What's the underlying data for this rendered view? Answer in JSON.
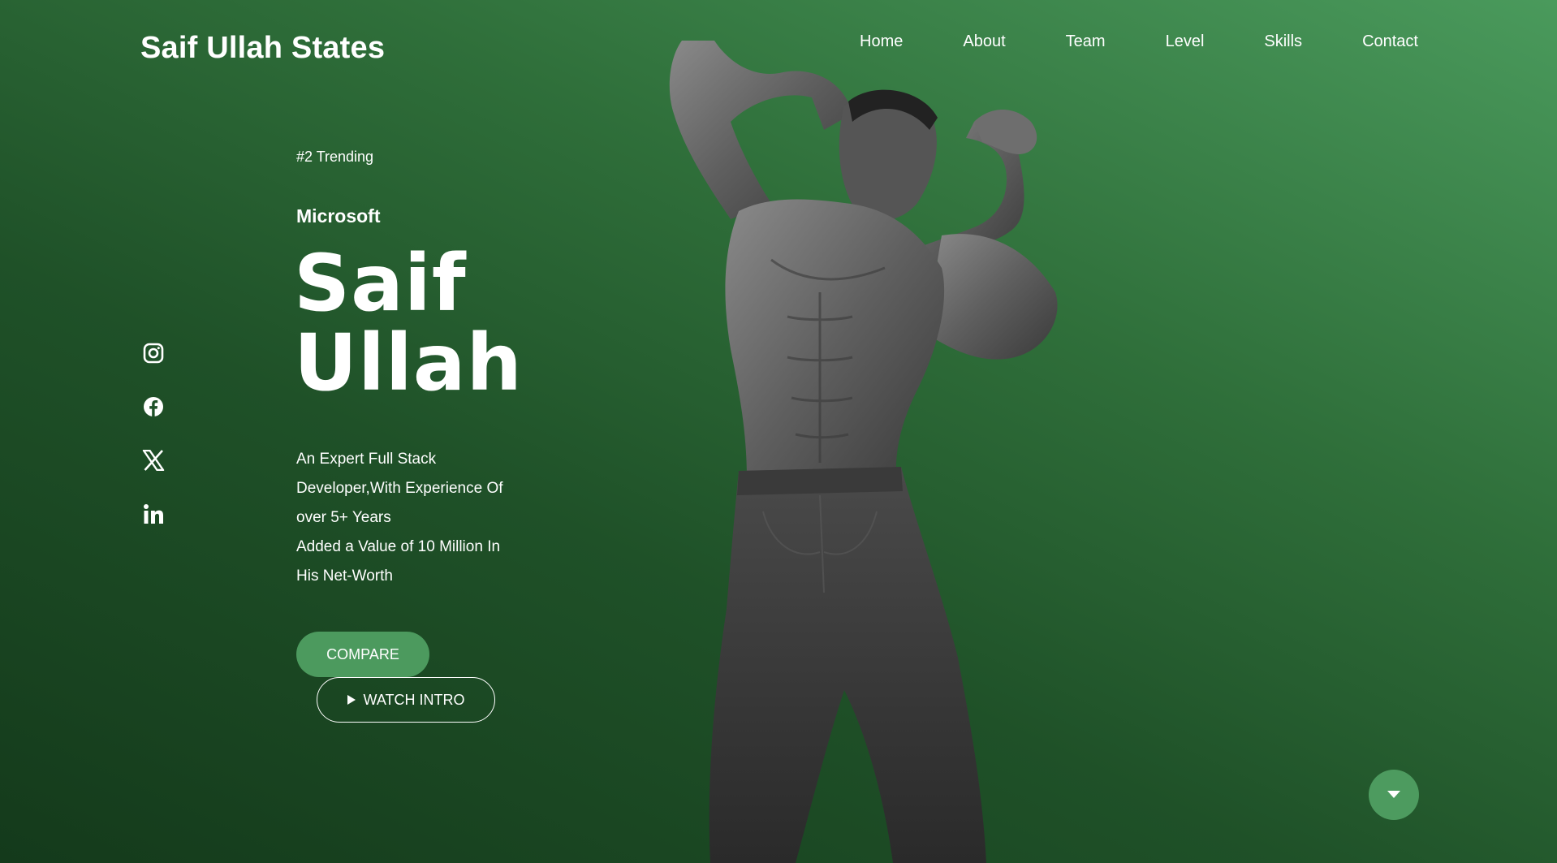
{
  "header": {
    "logo": "Saif Ullah States",
    "nav": [
      "Home",
      "About",
      "Team",
      "Level",
      "Skills",
      "Contact"
    ]
  },
  "socials": [
    {
      "icon": "instagram-icon"
    },
    {
      "icon": "facebook-icon"
    },
    {
      "icon": "x-icon"
    },
    {
      "icon": "linkedin-icon"
    }
  ],
  "hero": {
    "trending": "#2 Trending",
    "company": "Microsoft",
    "name_line1": "Saif",
    "name_line2": "Ullah",
    "description_lines": [
      "An Expert Full Stack",
      "Developer,With Experience Of",
      "over 5+ Years",
      "Added a Value of 10 Million In",
      "His Net-Worth"
    ],
    "compare_label": "COMPARE",
    "watch_label": "WATCH INTRO"
  },
  "colors": {
    "accent": "#4c9a5e",
    "background_dark": "#143a1b",
    "background_light": "#4a9a5c"
  }
}
